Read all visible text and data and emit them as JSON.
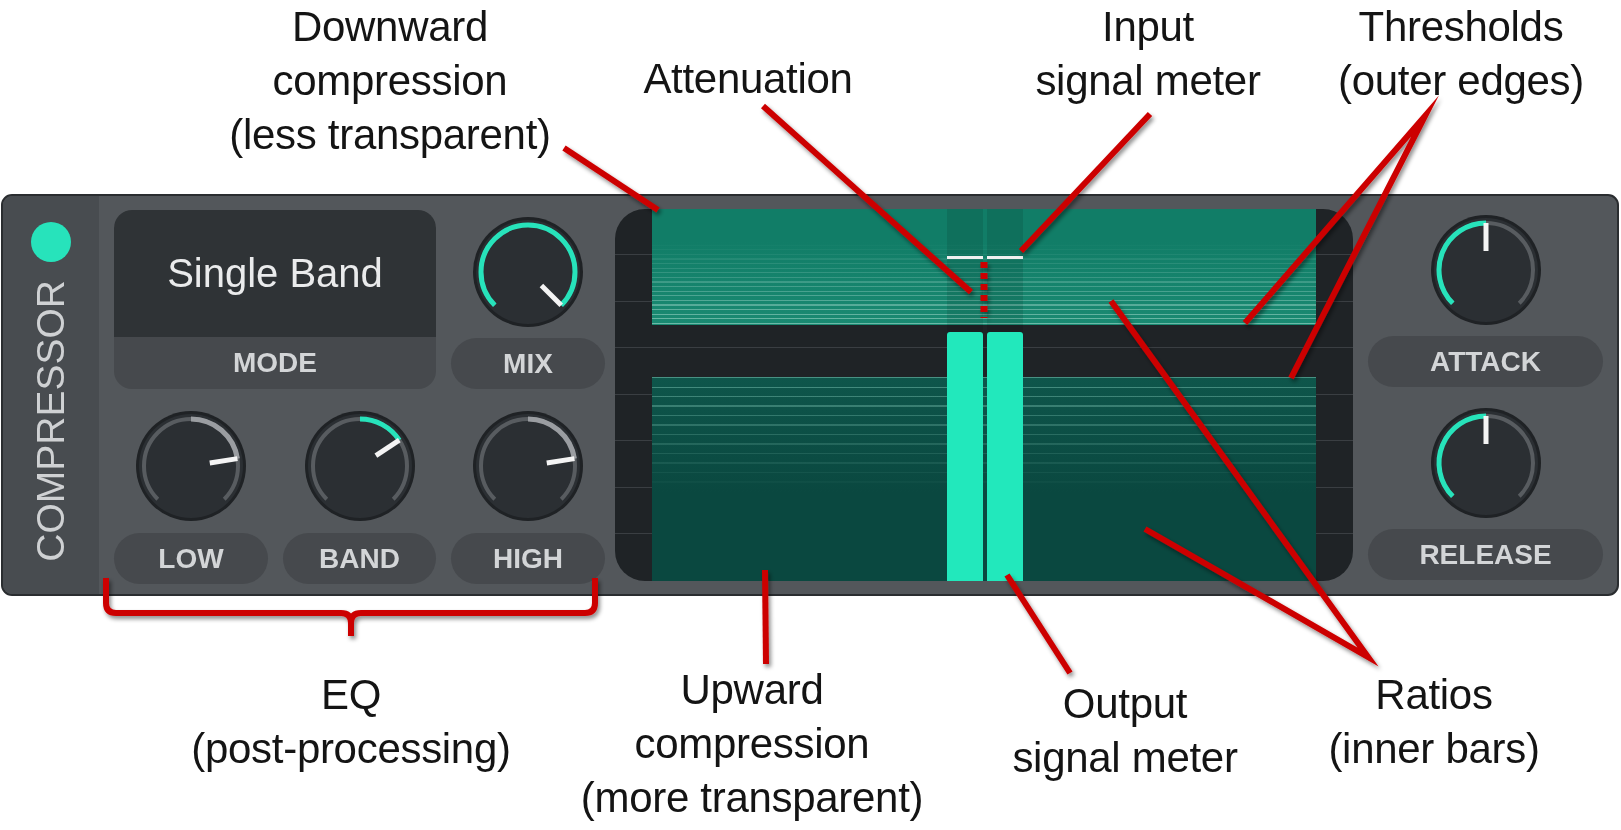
{
  "top_callouts": [
    {
      "lines": [
        "Downward",
        "compression",
        "(less transparent)"
      ]
    },
    {
      "lines": [
        "Attenuation"
      ]
    },
    {
      "lines": [
        "Input",
        "signal meter"
      ]
    },
    {
      "lines": [
        "Thresholds",
        "(outer edges)"
      ]
    }
  ],
  "panel": {
    "title": "COMPRESSOR",
    "power_on": true,
    "mode": {
      "value": "Single Band",
      "label": "MODE"
    },
    "mix_knob": {
      "label": "MIX",
      "kind": "unipolar",
      "level": 1,
      "enabled": true
    },
    "eq_knobs": [
      {
        "label": "LOW",
        "kind": "bipolar",
        "level": 0.8,
        "enabled": false
      },
      {
        "label": "BAND",
        "kind": "bipolar",
        "level": 0.71,
        "enabled": true
      },
      {
        "label": "HIGH",
        "kind": "bipolar",
        "level": 0.8,
        "enabled": false
      }
    ],
    "display": {
      "input_meter": [
        {
          "level": 0.87
        },
        {
          "level": 0.87
        }
      ],
      "output_meter": [
        {
          "level": 0.67
        },
        {
          "level": 0.67
        }
      ]
    },
    "dynamics_knobs": [
      {
        "label": "ATTACK",
        "kind": "unipolar",
        "level": 0.5,
        "enabled": true
      },
      {
        "label": "RELEASE",
        "kind": "unipolar",
        "level": 0.5,
        "enabled": true
      }
    ]
  },
  "bottom_callouts": [
    {
      "lines": [
        "EQ",
        "(post-processing)"
      ]
    },
    {
      "lines": [
        "Upward",
        "compression",
        "(more transparent)"
      ]
    },
    {
      "lines": [
        "Output",
        "signal meter"
      ]
    },
    {
      "lines": [
        "Ratios",
        "(inner bars)"
      ]
    }
  ]
}
